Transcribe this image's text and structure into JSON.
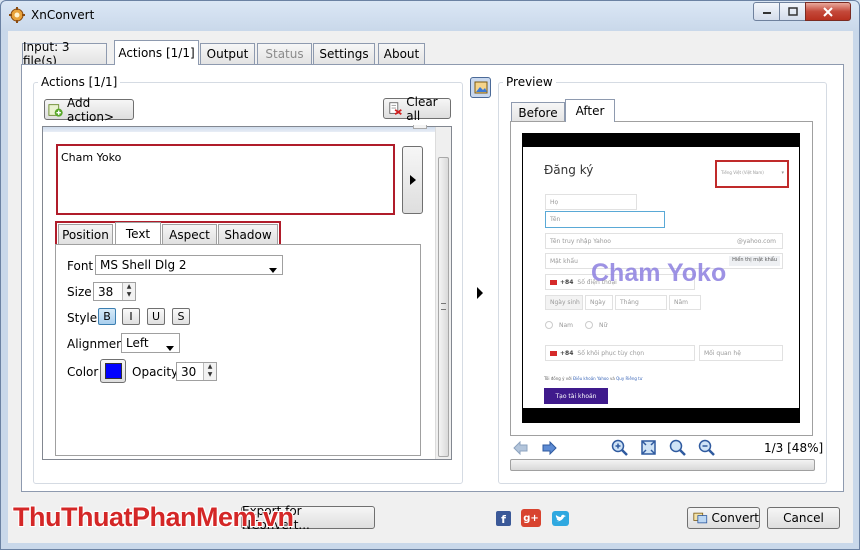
{
  "window": {
    "title": "XnConvert",
    "controls": {
      "minimize": "minimize",
      "maximize": "maximize",
      "close": "close"
    }
  },
  "tabs": [
    {
      "label": "Input: 3 file(s)"
    },
    {
      "label": "Actions [1/1]"
    },
    {
      "label": "Output"
    },
    {
      "label": "Status"
    },
    {
      "label": "Settings"
    },
    {
      "label": "About"
    }
  ],
  "actions_panel": {
    "group_label": "Actions [1/1]",
    "add_action_label": "Add action>",
    "clear_all_label": "Clear all",
    "text_value": "Cham Yoko",
    "subtabs": [
      "Position",
      "Text",
      "Aspect",
      "Shadow"
    ],
    "font": {
      "label": "Font",
      "value": "MS Shell Dlg 2"
    },
    "size": {
      "label": "Size",
      "value": "38"
    },
    "style": {
      "label": "Style",
      "buttons": [
        "B",
        "I",
        "U",
        "S"
      ]
    },
    "alignment": {
      "label": "Alignment",
      "value": "Left"
    },
    "color": {
      "label": "Color",
      "swatch": "#0000ff"
    },
    "opacity": {
      "label": "Opacity",
      "value": "30"
    }
  },
  "preview": {
    "group_label": "Preview",
    "tabs": [
      "Before",
      "After"
    ],
    "page_info": "1/3 [48%]",
    "form": {
      "heading": "Đăng ký",
      "language": "Tiếng Việt (Việt Nam)",
      "first_name": "Họ",
      "last_name": "Tên",
      "username": "Tên truy nhập Yahoo",
      "domain": "@yahoo.com",
      "password": "Mật khẩu",
      "show_password": "Hiển thị mật khẩu",
      "country_code": "+84",
      "phone": "Số điện thoại",
      "birthday": "Ngày sinh",
      "day": "Ngày",
      "month": "Tháng",
      "year": "Năm",
      "male": "Nam",
      "female": "Nữ",
      "recovery_phone": "Số khôi phục tùy chọn",
      "relationship": "Mối quan hệ",
      "terms_prefix": "Tôi đồng ý với",
      "terms_link": "Điều khoản Yahoo",
      "terms_and": "và",
      "privacy_link": "Quy Riêng tư",
      "submit": "Tạo tài khoản"
    },
    "watermark": "Cham Yoko"
  },
  "footer": {
    "export_label": "Export for NConvert...",
    "convert_label": "Convert",
    "cancel_label": "Cancel",
    "overlay_logo": "ThuThuatPhanMem.vn"
  },
  "colors": {
    "accent_red": "#b01c2a",
    "text_color": "#0000ff",
    "watermark": "#8c7fe0",
    "submit_bg": "#3f1a8c"
  }
}
